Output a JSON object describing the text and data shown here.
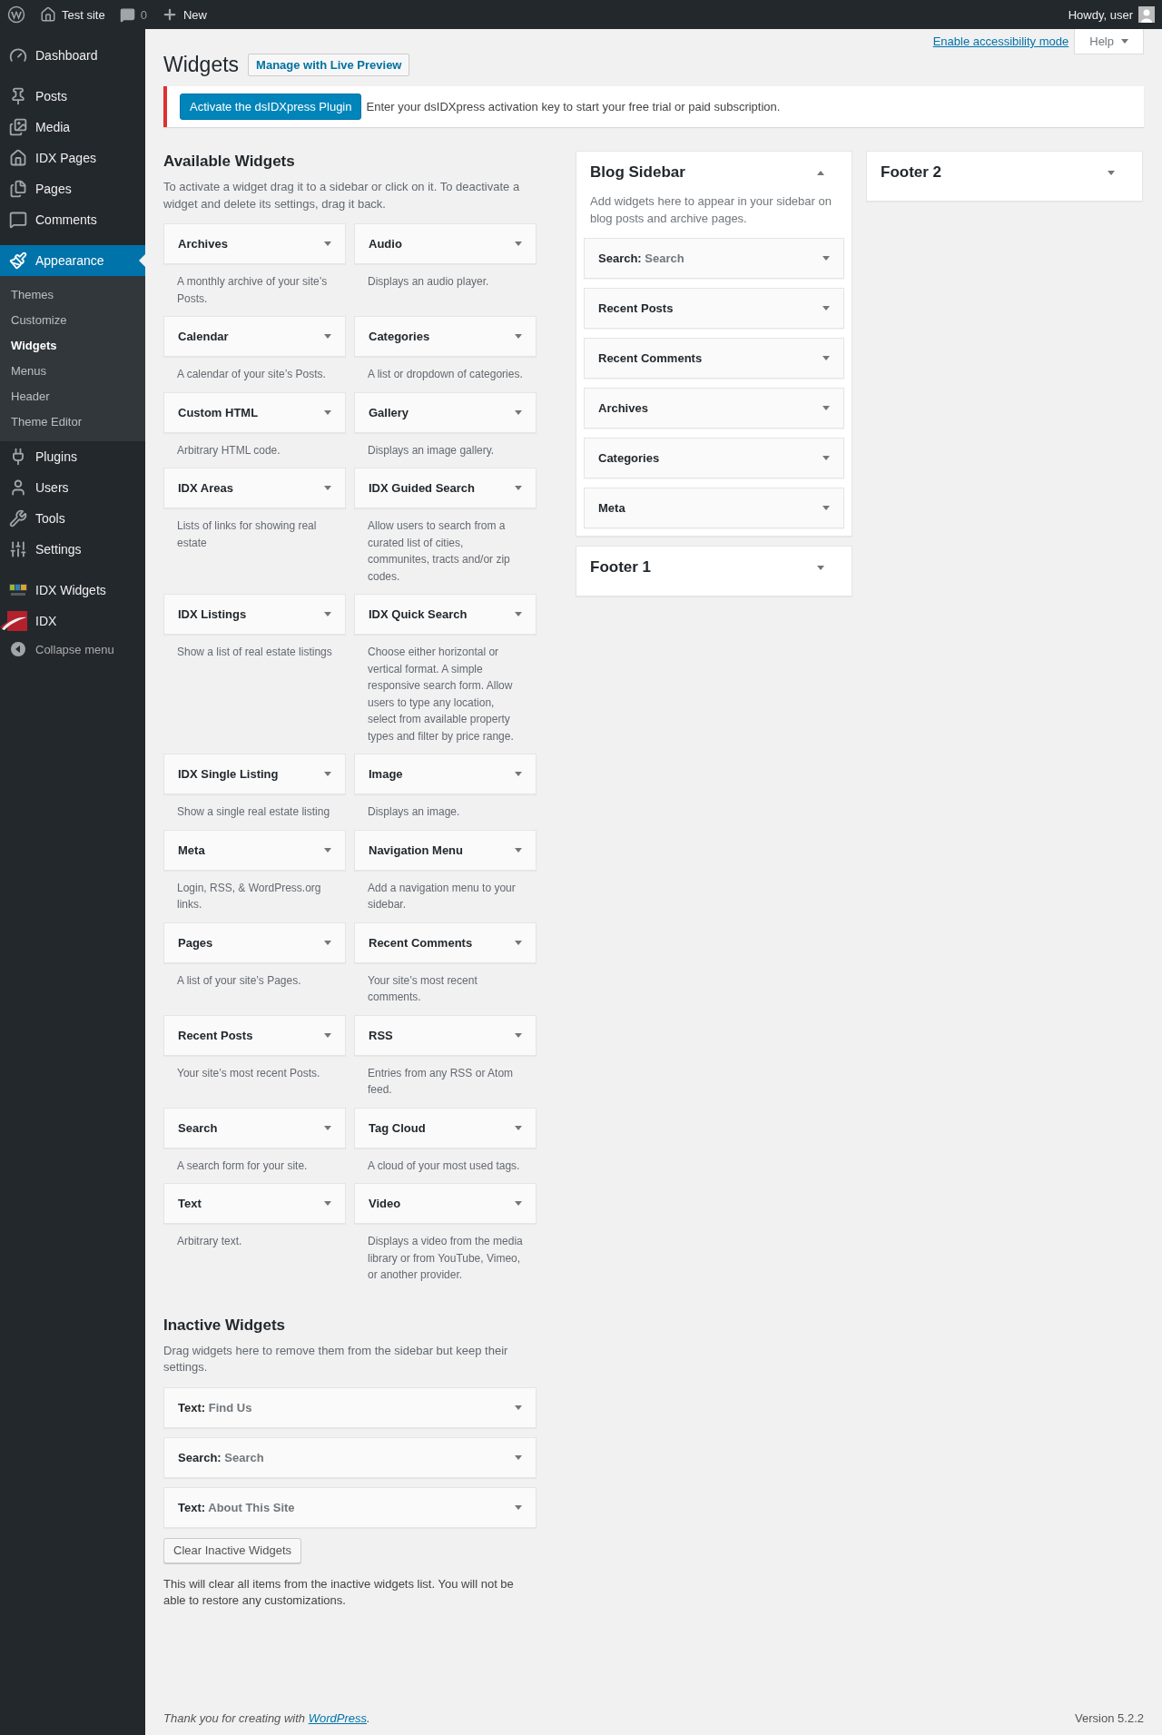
{
  "admin_bar": {
    "site": "Test site",
    "comments": "0",
    "new": "New",
    "greeting": "Howdy, user"
  },
  "menu": [
    [
      {
        "label": "Dashboard",
        "selected": false
      }
    ],
    [
      {
        "label": "Posts",
        "selected": false
      },
      {
        "label": "Media",
        "selected": false
      },
      {
        "label": "IDX Pages",
        "selected": false
      },
      {
        "label": "Pages",
        "selected": false
      },
      {
        "label": "Comments",
        "selected": false
      }
    ],
    [
      {
        "label": "Appearance",
        "selected": true,
        "children": [
          {
            "label": "Themes",
            "selected": false
          },
          {
            "label": "Customize",
            "selected": false
          },
          {
            "label": "Widgets",
            "selected": true
          },
          {
            "label": "Menus",
            "selected": false
          },
          {
            "label": "Header",
            "selected": false
          },
          {
            "label": "Theme Editor",
            "selected": false
          }
        ]
      },
      {
        "label": "Plugins",
        "selected": false
      },
      {
        "label": "Users",
        "selected": false
      },
      {
        "label": "Tools",
        "selected": false
      },
      {
        "label": "Settings",
        "selected": false
      }
    ],
    [
      {
        "label": "IDX Widgets",
        "selected": false
      },
      {
        "label": "IDX",
        "selected": false
      }
    ]
  ],
  "collapse": "Collapse menu",
  "page": {
    "title": "Widgets",
    "action": "Manage with Live Preview",
    "accessibility_link": "Enable accessibility mode",
    "help": "Help"
  },
  "notice": {
    "button": "Activate the dsIDXpress Plugin",
    "text": "Enter your dsIDXpress activation key to start your free trial or paid subscription."
  },
  "available": {
    "heading": "Available Widgets",
    "description": "To activate a widget drag it to a sidebar or click on it. To deactivate a widget and delete its settings, drag it back.",
    "widgets": [
      {
        "title": "Archives",
        "description": "A monthly archive of your site’s Posts."
      },
      {
        "title": "Audio",
        "description": "Displays an audio player."
      },
      {
        "title": "Calendar",
        "description": "A calendar of your site’s Posts."
      },
      {
        "title": "Categories",
        "description": "A list or dropdown of categories."
      },
      {
        "title": "Custom HTML",
        "description": "Arbitrary HTML code."
      },
      {
        "title": "Gallery",
        "description": "Displays an image gallery."
      },
      {
        "title": "IDX Areas",
        "description": "Lists of links for showing real estate"
      },
      {
        "title": "IDX Guided Search",
        "description": "Allow users to search from a curated list of cities, communites, tracts and/or zip codes."
      },
      {
        "title": "IDX Listings",
        "description": "Show a list of real estate listings"
      },
      {
        "title": "IDX Quick Search",
        "description": "Choose either horizontal or vertical format. A simple responsive search form. Allow users to type any location, select from available property types and filter by price range."
      },
      {
        "title": "IDX Single Listing",
        "description": "Show a single real estate listing"
      },
      {
        "title": "Image",
        "description": "Displays an image."
      },
      {
        "title": "Meta",
        "description": "Login, RSS, & WordPress.org links."
      },
      {
        "title": "Navigation Menu",
        "description": "Add a navigation menu to your sidebar."
      },
      {
        "title": "Pages",
        "description": "A list of your site’s Pages."
      },
      {
        "title": "Recent Comments",
        "description": "Your site’s most recent comments."
      },
      {
        "title": "Recent Posts",
        "description": "Your site’s most recent Posts."
      },
      {
        "title": "RSS",
        "description": "Entries from any RSS or Atom feed."
      },
      {
        "title": "Search",
        "description": "A search form for your site."
      },
      {
        "title": "Tag Cloud",
        "description": "A cloud of your most used tags."
      },
      {
        "title": "Text",
        "description": "Arbitrary text."
      },
      {
        "title": "Video",
        "description": "Displays a video from the media library or from YouTube, Vimeo, or another provider."
      }
    ]
  },
  "inactive": {
    "heading": "Inactive Widgets",
    "description": "Drag widgets here to remove them from the sidebar but keep their settings.",
    "widgets": [
      {
        "title": "Text:",
        "subtitle": "Find Us"
      },
      {
        "title": "Search:",
        "subtitle": "Search"
      },
      {
        "title": "Text:",
        "subtitle": "About This Site"
      }
    ],
    "clear_button": "Clear Inactive Widgets",
    "note": "This will clear all items from the inactive widgets list. You will not be able to restore any customizations."
  },
  "sidebar_columns": [
    [
      {
        "title": "Blog Sidebar",
        "expanded": true,
        "description": "Add widgets here to appear in your sidebar on blog posts and archive pages.",
        "widgets": [
          {
            "title": "Search:",
            "subtitle": "Search"
          },
          {
            "title": "Recent Posts"
          },
          {
            "title": "Recent Comments"
          },
          {
            "title": "Archives"
          },
          {
            "title": "Categories"
          },
          {
            "title": "Meta"
          }
        ]
      },
      {
        "title": "Footer 1",
        "expanded": false
      }
    ],
    [
      {
        "title": "Footer 2",
        "expanded": false
      }
    ]
  ],
  "footer": {
    "before": "Thank you for creating with",
    "link": "WordPress",
    "after": ".",
    "version": "Version 5.2.2"
  }
}
